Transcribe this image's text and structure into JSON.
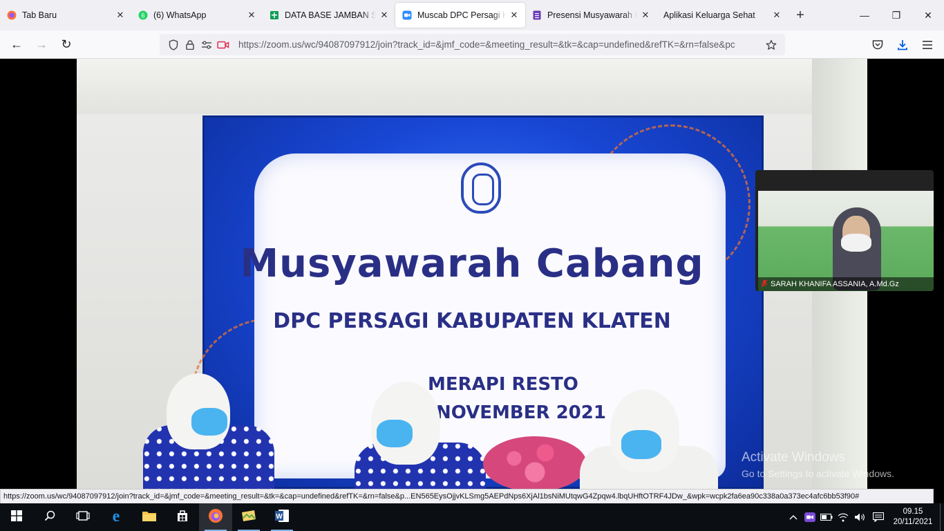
{
  "tabs": [
    {
      "title": "Tab Baru",
      "icon": "firefox-icon",
      "color": "#e66000",
      "active": false
    },
    {
      "title": "(6) WhatsApp",
      "icon": "whatsapp-icon",
      "color": "#25d366",
      "badge": "6",
      "active": false
    },
    {
      "title": "DATA BASE JAMBAN SEH",
      "icon": "sheets-icon",
      "color": "#0f9d58",
      "active": false
    },
    {
      "title": "Muscab DPC Persagi Klat",
      "icon": "zoom-icon",
      "color": "#2d8cff",
      "active": true
    },
    {
      "title": "Presensi Musyawarah Cal",
      "icon": "forms-icon",
      "color": "#673ab7",
      "active": false
    },
    {
      "title": "Aplikasi Keluarga Sehat",
      "icon": "blank-page-icon",
      "color": "#ffffff",
      "active": false
    }
  ],
  "tab_close_glyph": "✕",
  "new_tab_glyph": "+",
  "window_controls": {
    "minimize": "—",
    "maximize": "❐",
    "close": "✕"
  },
  "nav": {
    "back": "←",
    "forward": "→",
    "reload": "↻",
    "url": "https://zoom.us/wc/94087097912/join?track_id=&jmf_code=&meeting_result=&tk=&cap=undefined&refTK=&rn=false&pc"
  },
  "banner": {
    "title": "Musyawarah Cabang",
    "subtitle": "DPC PERSAGI KABUPATEN KLATEN",
    "place": "MERAPI RESTO",
    "date": "NOVEMBER 2021"
  },
  "selfview": {
    "name": "SARAH KHANIFA ASSANIA, A.Md.Gz",
    "mic_glyph": "🎤"
  },
  "watermark": {
    "line1": "Activate Windows",
    "line2": "Go to Settings to activate Windows."
  },
  "status_url": "https://zoom.us/wc/94087097912/join?track_id=&jmf_code=&meeting_result=&tk=&cap=undefined&refTK=&rn=false&p...EN565EysOjjvKLSmg5AEPdNps6XjAl1bsNiMUtqwG4Zpqw4.lbqUHftOTRF4JDw_&wpk=wcpk2fa6ea90c338a0a373ec4afc6bb53f90#",
  "taskbar": {
    "apps": [
      {
        "name": "start-icon",
        "glyph": "⊞"
      },
      {
        "name": "search-icon",
        "glyph": "⚲"
      },
      {
        "name": "task-view-icon",
        "glyph": "▭"
      },
      {
        "name": "edge-icon",
        "glyph": "e"
      },
      {
        "name": "file-explorer-icon",
        "glyph": "▬"
      },
      {
        "name": "store-icon",
        "glyph": "▦"
      },
      {
        "name": "firefox-icon",
        "glyph": "◉"
      },
      {
        "name": "photos-icon",
        "glyph": "▰"
      },
      {
        "name": "word-icon",
        "glyph": "W"
      }
    ],
    "time": "09.15",
    "date": "20/11/2021"
  }
}
